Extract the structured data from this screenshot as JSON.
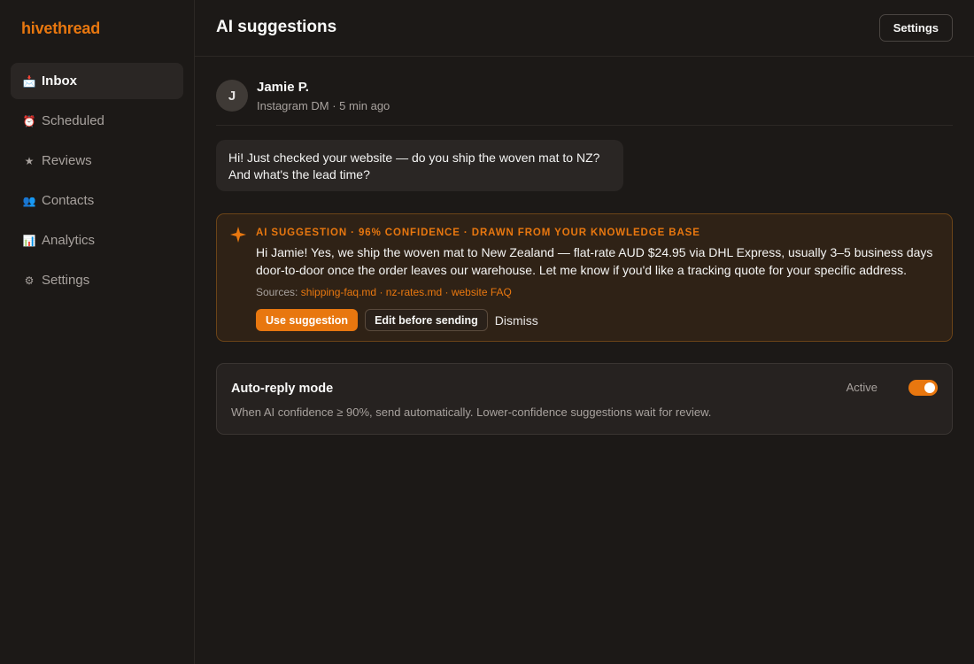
{
  "app": {
    "logo": "hivethread"
  },
  "sidebar": {
    "items": [
      {
        "icon": "📩",
        "icon_name": "inbox-tray-icon",
        "label": "Inbox",
        "active": true
      },
      {
        "icon": "⏰",
        "icon_name": "alarm-clock-icon",
        "label": "Scheduled"
      },
      {
        "icon": "★",
        "icon_name": "star-icon",
        "label": "Reviews"
      },
      {
        "icon": "👥",
        "icon_name": "contacts-icon",
        "label": "Contacts"
      },
      {
        "icon": "📊",
        "icon_name": "bar-chart-icon",
        "label": "Analytics"
      },
      {
        "icon": "⚙",
        "icon_name": "gear-icon",
        "label": "Settings"
      }
    ]
  },
  "header": {
    "title": "AI suggestions",
    "settings_label": "Settings"
  },
  "conversation": {
    "sender": {
      "initial": "J",
      "name": "Jamie P.",
      "meta": "Instagram DM · 5 min ago"
    },
    "message": "Hi! Just checked your website — do you ship the woven mat to NZ? And what's the lead time?"
  },
  "suggestion": {
    "label": "AI SUGGESTION · 96% CONFIDENCE · DRAWN FROM YOUR KNOWLEDGE BASE",
    "text": "Hi Jamie! Yes, we ship the woven mat to New Zealand — flat-rate AUD $24.95 via DHL Express, usually 3–5 business days door-to-door once the order leaves our warehouse. Let me know if you'd like a tracking quote for your specific address.",
    "sources_prefix": "Sources:",
    "sources": [
      "shipping-faq.md",
      "nz-rates.md",
      "website FAQ"
    ],
    "separator": "·",
    "actions": {
      "use": "Use suggestion",
      "edit": "Edit before sending",
      "dismiss": "Dismiss"
    }
  },
  "autoreply": {
    "title": "Auto-reply mode",
    "description": "When AI confidence ≥ 90%, send automatically. Lower-confidence suggestions wait for review.",
    "status": "Active",
    "enabled": true
  },
  "colors": {
    "accent": "#e8770f",
    "background": "#1c1917",
    "suggestion_bg": "#2f2216"
  }
}
